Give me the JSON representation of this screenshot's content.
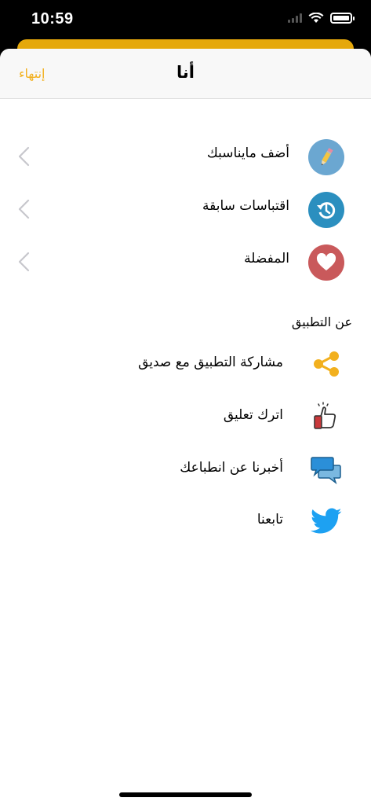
{
  "status_bar": {
    "time": "10:59",
    "cell_icon": "cellular-signal-icon",
    "wifi_icon": "wifi-icon",
    "battery_icon": "battery-icon"
  },
  "colors": {
    "accent": "#f2b01e",
    "back_card": "#e5a80b"
  },
  "nav": {
    "title": "أنا",
    "done_label": "إنتهاء"
  },
  "menu": [
    {
      "label": "أضف مايناسبك",
      "icon": "pencil-icon",
      "icon_bg": "#6ba7d1"
    },
    {
      "label": "اقتباسات سابقة",
      "icon": "history-icon",
      "icon_bg": "#2b8fbf"
    },
    {
      "label": "المفضلة",
      "icon": "heart-icon",
      "icon_bg": "#c9595b"
    }
  ],
  "about": {
    "header": "عن التطبيق",
    "items": [
      {
        "label": "مشاركة التطبيق مع صديق",
        "icon": "share-icon"
      },
      {
        "label": "اترك تعليق",
        "icon": "thumbs-up-icon"
      },
      {
        "label": "أخبرنا عن انطباعك",
        "icon": "chat-bubbles-icon"
      },
      {
        "label": "تابعنا",
        "icon": "twitter-icon"
      }
    ]
  }
}
